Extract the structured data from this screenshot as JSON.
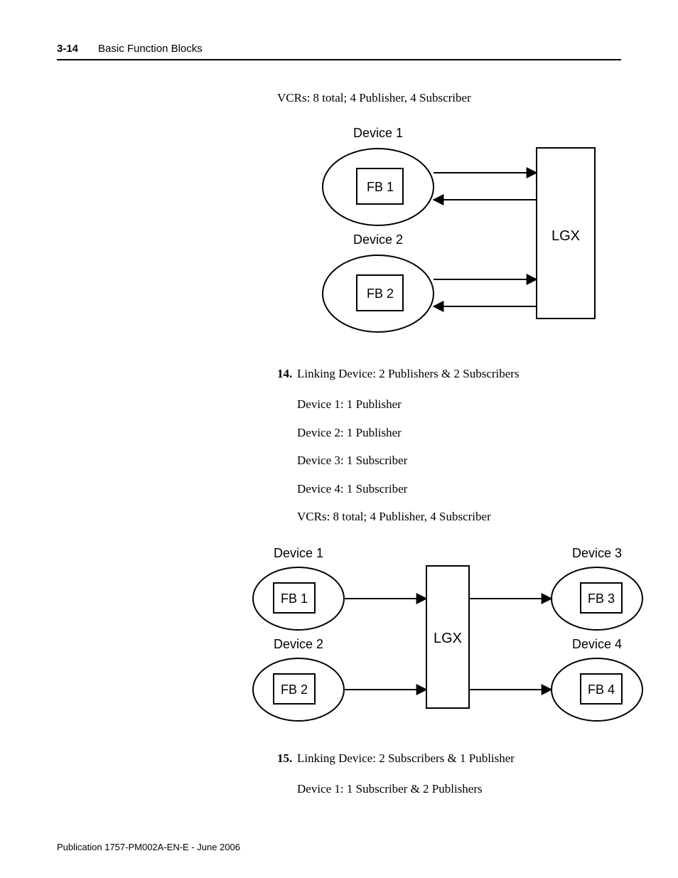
{
  "header": {
    "page_number": "3-14",
    "section": "Basic Function Blocks"
  },
  "intro_line": "VCRs: 8 total; 4 Publisher, 4 Subscriber",
  "diagram1": {
    "device1": "Device 1",
    "device2": "Device 2",
    "fb1": "FB 1",
    "fb2": "FB 2",
    "lgx": "LGX"
  },
  "item14": {
    "num": "14.",
    "title": "Linking Device: 2 Publishers & 2 Subscribers",
    "l1": "Device 1: 1 Publisher",
    "l2": "Device 2: 1 Publisher",
    "l3": "Device 3: 1 Subscriber",
    "l4": "Device 4: 1 Subscriber",
    "l5": "VCRs: 8 total; 4 Publisher, 4 Subscriber"
  },
  "diagram2": {
    "device1": "Device 1",
    "device2": "Device 2",
    "device3": "Device 3",
    "device4": "Device 4",
    "fb1": "FB 1",
    "fb2": "FB 2",
    "fb3": "FB 3",
    "fb4": "FB 4",
    "lgx": "LGX"
  },
  "item15": {
    "num": "15.",
    "title": "Linking Device: 2 Subscribers & 1 Publisher",
    "l1": "Device 1: 1 Subscriber & 2 Publishers"
  },
  "footer": "Publication 1757-PM002A-EN-E - June 2006"
}
